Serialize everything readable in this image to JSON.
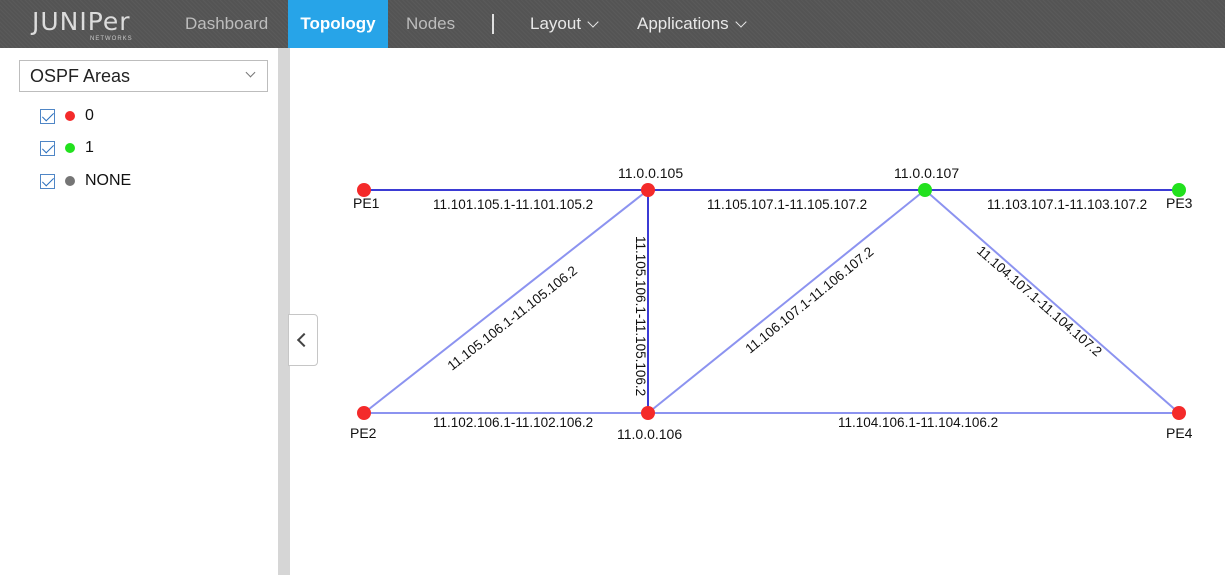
{
  "header": {
    "logo_word": "JUNIPer",
    "logo_sub": "NETWORKS",
    "nav": {
      "dashboard": "Dashboard",
      "topology": "Topology",
      "nodes": "Nodes",
      "layout": "Layout",
      "applications": "Applications"
    }
  },
  "sidebar": {
    "selector_value": "OSPF Areas",
    "legend": [
      {
        "label": "0",
        "color": "#f42a2a",
        "checked": true
      },
      {
        "label": "1",
        "color": "#22e11e",
        "checked": true
      },
      {
        "label": "NONE",
        "color": "#757575",
        "checked": true
      }
    ]
  },
  "colors": {
    "accent": "#27a4e8",
    "link": "#8c93f0",
    "link_dark": "#3b3bd4",
    "area0": "#f42a2a",
    "area1": "#22e11e"
  },
  "topology": {
    "nodes": {
      "pe1": "PE1",
      "pe2": "PE2",
      "pe3": "PE3",
      "pe4": "PE4",
      "n105": "11.0.0.105",
      "n106": "11.0.0.106",
      "n107": "11.0.0.107"
    },
    "links": {
      "pe1_105": "11.101.105.1-11.101.105.2",
      "n105_107": "11.105.107.1-11.105.107.2",
      "n107_pe3": "11.103.107.1-11.103.107.2",
      "pe2_105": "11.105.106.1-11.105.106.2",
      "n105_106": "11.105.106.1-11.105.106.2",
      "n106_107": "11.106.107.1-11.106.107.2",
      "n107_pe4": "11.104.107.1-11.104.107.2",
      "pe2_106": "11.102.106.1-11.102.106.2",
      "n106_pe4": "11.104.106.1-11.104.106.2"
    }
  }
}
